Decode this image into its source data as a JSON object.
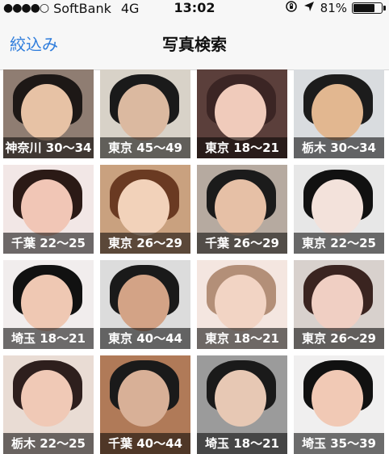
{
  "status_bar": {
    "signal": "●●●●○",
    "carrier": "SoftBank",
    "network": "4G",
    "time": "13:02",
    "lock_icon": "rotation-lock-icon",
    "location_icon": "location-arrow-icon",
    "battery_percent": "81%",
    "battery_level": 0.81
  },
  "nav": {
    "left_label": "絞込み",
    "title": "写真検索",
    "accent_color": "#2f7ddc"
  },
  "grid": {
    "tiles": [
      {
        "caption": "神奈川 30〜34",
        "bg": "#8f7d72",
        "hair": "#1d1816",
        "skin": "#e7c2a5"
      },
      {
        "caption": "東京 45〜49",
        "bg": "#d8d2c8",
        "hair": "#1a1a1a",
        "skin": "#dbb9a0"
      },
      {
        "caption": "東京 18〜21",
        "bg": "#5b3f3b",
        "hair": "#3b2524",
        "skin": "#f0cbbb"
      },
      {
        "caption": "栃木 30〜34",
        "bg": "#d9dcdf",
        "hair": "#1c1c1c",
        "skin": "#e2b790"
      },
      {
        "caption": "千葉 22〜25",
        "bg": "#f2e7e6",
        "hair": "#2b1a16",
        "skin": "#f1c6b6"
      },
      {
        "caption": "東京 26〜29",
        "bg": "#c9a17f",
        "hair": "#6a3a22",
        "skin": "#f2d2ba"
      },
      {
        "caption": "千葉 26〜29",
        "bg": "#b6aaa0",
        "hair": "#1b1b1b",
        "skin": "#e6c0a6"
      },
      {
        "caption": "東京 22〜25",
        "bg": "#e7e7e7",
        "hair": "#111111",
        "skin": "#f3e2db"
      },
      {
        "caption": "埼玉 18〜21",
        "bg": "#f1eded",
        "hair": "#111111",
        "skin": "#efc8b3"
      },
      {
        "caption": "東京 40〜44",
        "bg": "#dcdcdc",
        "hair": "#1a1a1a",
        "skin": "#d3a386"
      },
      {
        "caption": "東京 18〜21",
        "bg": "#f4e6e0",
        "hair": "#b38f78",
        "skin": "#f2d4c4"
      },
      {
        "caption": "東京 26〜29",
        "bg": "#d8d1cd",
        "hair": "#3a2420",
        "skin": "#f0cfc3"
      },
      {
        "caption": "栃木 22〜25",
        "bg": "#e9dcd4",
        "hair": "#2e1f1d",
        "skin": "#f0c9b6"
      },
      {
        "caption": "千葉 40〜44",
        "bg": "#b07a58",
        "hair": "#1a1a1a",
        "skin": "#d8b097"
      },
      {
        "caption": "埼玉 18〜21",
        "bg": "#9b9b9b",
        "hair": "#1a1a1a",
        "skin": "#e7c8b4"
      },
      {
        "caption": "埼玉 35〜39",
        "bg": "#f0efef",
        "hair": "#111111",
        "skin": "#f1c9b5"
      }
    ]
  }
}
